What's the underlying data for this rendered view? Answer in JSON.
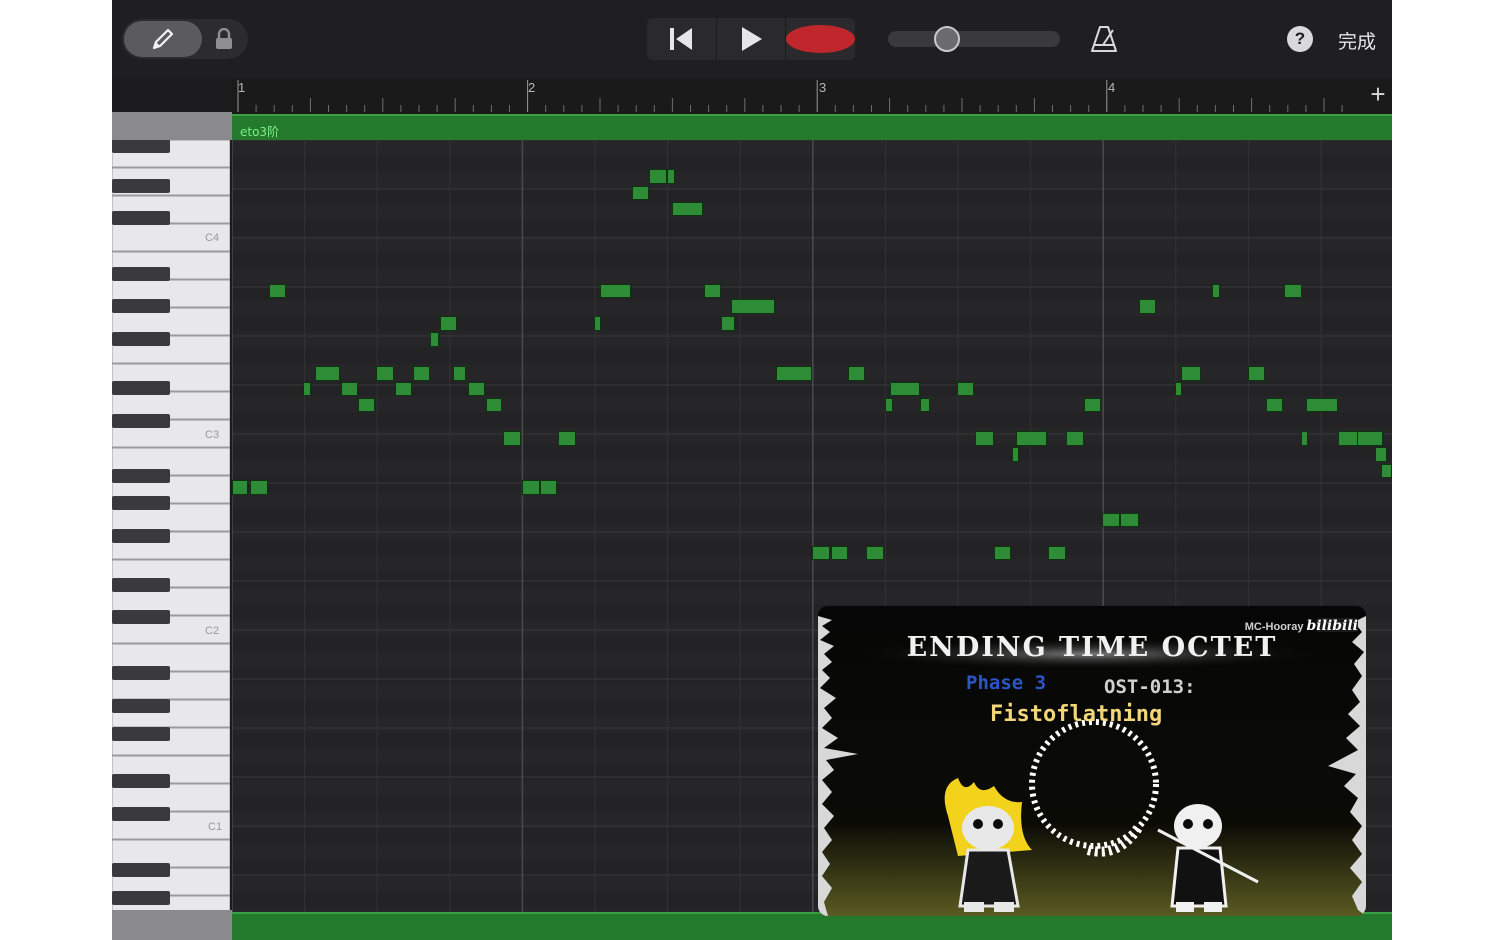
{
  "toolbar": {
    "done_label": "完成",
    "help_label": "?",
    "icons": [
      "pencil-icon",
      "lock-icon",
      "rewind-icon",
      "play-icon",
      "record-icon",
      "metronome-icon",
      "help-icon",
      "plus-icon"
    ]
  },
  "ruler": {
    "bars": [
      "1",
      "2",
      "3",
      "4"
    ],
    "add_label": "+"
  },
  "region": {
    "name": "eto3阶"
  },
  "keyboard": {
    "octave_labels": [
      "C4",
      "C3",
      "C2",
      "C1"
    ]
  },
  "thumbnail": {
    "channel": "MC-Hooray",
    "platform": "bilibili",
    "title": "ENDING TIME OCTET",
    "phase": "Phase 3",
    "ost": "OST-013:",
    "song": "Fistoflatning"
  },
  "colors": {
    "note_fill": "#2e8b36",
    "region": "#237a2c",
    "record": "#c0272d",
    "background": "#1c1c1e"
  }
}
